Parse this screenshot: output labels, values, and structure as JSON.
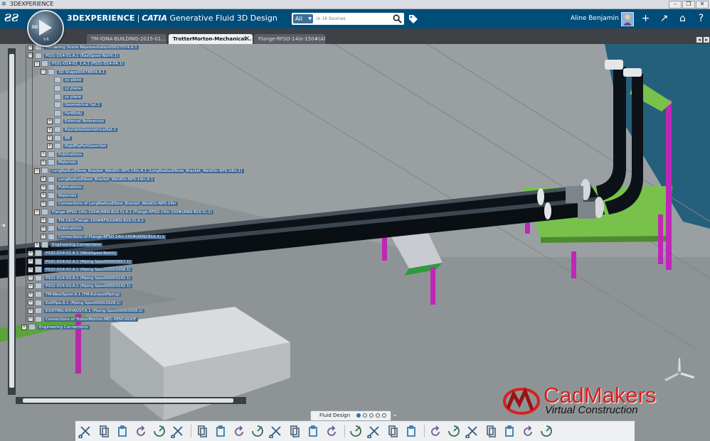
{
  "window": {
    "title": "3DEXPERIENCE",
    "controls": [
      "–",
      "❐",
      "✕"
    ]
  },
  "header": {
    "brand": "3DEXPERIENCE",
    "separator": "|",
    "product": "CATIA",
    "app": "Generative Fluid 3D Design",
    "search": {
      "scope": "All",
      "placeholder": "in 16 Sources"
    },
    "user": "Aline Benjamin",
    "buttons": [
      "+",
      "↗",
      "⌂",
      "?"
    ]
  },
  "compass": {
    "label": "3D",
    "version": "V.R"
  },
  "tabs": [
    {
      "label": "TM-IONA-BUILDING-2015-01...",
      "active": false
    },
    {
      "label": "TrotterMorton-Mechanical...",
      "active": true,
      "close": "✕"
    },
    {
      "label": "Flange-RFSO-14in-150#(AN...",
      "active": false
    }
  ],
  "tab_nav": [
    "◂",
    "▸"
  ],
  "tree": [
    {
      "expander": "+",
      "label": "Rendering Scene Representation00027074.A.1"
    },
    {
      "expander": "−",
      "label": "PS31-D14-01.A.1 (EastSpool-North.1)"
    },
    {
      "expander": "−",
      "label": "PS31-D14-01_1.A.1 (PS31-D14-04.1)"
    },
    {
      "expander": "−",
      "label": "3D Shape00474834.A.1"
    },
    {
      "expander": "",
      "label": "xy plane"
    },
    {
      "expander": "",
      "label": "yz plane"
    },
    {
      "expander": "",
      "label": "zx plane"
    },
    {
      "expander": "",
      "label": "Geometrical Set.1"
    },
    {
      "expander": "",
      "label": "PartBody"
    },
    {
      "expander": "+",
      "label": "External References"
    },
    {
      "expander": "+",
      "label": "RoutableGeometricalSet.1"
    },
    {
      "expander": "+",
      "label": "BB"
    },
    {
      "expander": "+",
      "label": "RigidPipPortGeomSet"
    },
    {
      "expander": "+",
      "label": "Publications"
    },
    {
      "expander": "+",
      "label": "Materials"
    },
    {
      "expander": "−",
      "label": "LongRadiusElbow_Bracket_WeldOn-NPS-14in.A.1 (LongRadiusElbow_Bracket_WeldOn-NPS-14in.1)"
    },
    {
      "expander": "+",
      "label": "LongRadiusElbow_Bracket_WeldOn-NPS-14in.A.1"
    },
    {
      "expander": "+",
      "label": "Publications"
    },
    {
      "expander": "+",
      "label": "Materials"
    },
    {
      "expander": "+",
      "label": "Connections of LongRadiusElbow_Bracket_WeldOn-NPS-14in"
    },
    {
      "expander": "−",
      "label": "Flange-RFSO-14in-150#(ANSI-B16.5).A.1 (Flange-RFSO-14in-150#(ANSI-B16.5).1)"
    },
    {
      "expander": "+",
      "label": "TM-14in-Flange-150#RFSO(ANSI-B16.5).A.1"
    },
    {
      "expander": "+",
      "label": "Publications"
    },
    {
      "expander": "+",
      "label": "Connections of Flange-RFSO-14in-150#(ANSI-B16.5).1"
    },
    {
      "expander": "+",
      "label": "Engineering Connections"
    },
    {
      "expander": "+",
      "label": "PS32-D14-01.A.1 (WestSpool-North)"
    },
    {
      "expander": "+",
      "label": "PS31-D14-02.A.1 (Piping Spool00003057.1)"
    },
    {
      "expander": "+",
      "label": "PS32-D14-02.A.1 (Piping Spool00003056.1)"
    },
    {
      "expander": "+",
      "label": "PS31-D14-03.A.1 (Piping Spool00003141.1)"
    },
    {
      "expander": "+",
      "label": "PS32-D14-03.A.1 (Piping Spool00003142.1)"
    },
    {
      "expander": "+",
      "label": "TM-WestSpool.A.1 (TM-ExhaustPiping)"
    },
    {
      "expander": "+",
      "label": "ExitPipe.A.1 (Piping Spool00002628.1)"
    },
    {
      "expander": "+",
      "label": "EXISTING-EXHAUST.A.1 (Piping Spool00003058.1)"
    },
    {
      "expander": "+",
      "label": "Connections of TrotterMorton-MEC-PENT-ROOF"
    },
    {
      "expander": "+",
      "label": "Engineering Connections"
    }
  ],
  "viewport": {
    "collapse_arrow": "◂"
  },
  "logo": {
    "main": "CadMakers",
    "sub": "Virtual Construction"
  },
  "workbench": {
    "name": "Fluid Design",
    "pages": 5,
    "active_page": 1,
    "expand": "⌄"
  },
  "toolbar_icons": [
    "scissors-icon",
    "copy-icon",
    "paste-icon",
    "undo-icon",
    "update-icon",
    "tree-icon",
    "box-icon",
    "spline-icon",
    "pipe-icon",
    "route-icon",
    "part-icon",
    "grid-icon",
    "select-icon",
    "next-icon",
    "connect-icon",
    "bracket-icon",
    "flange-icon",
    "valve-icon",
    "hierarchy-icon",
    "branch-icon",
    "split-icon",
    "spool-icon",
    "merge-icon",
    "list-icon",
    "analyze-icon"
  ],
  "colors": {
    "header": "#004d7a",
    "tree_label": "#426a93",
    "pipe": "#0d1218",
    "support_green": "#78c24b",
    "support_magenta": "#c026b8",
    "roof_teal": "#1f5d79",
    "logo_red": "#d8201c"
  }
}
